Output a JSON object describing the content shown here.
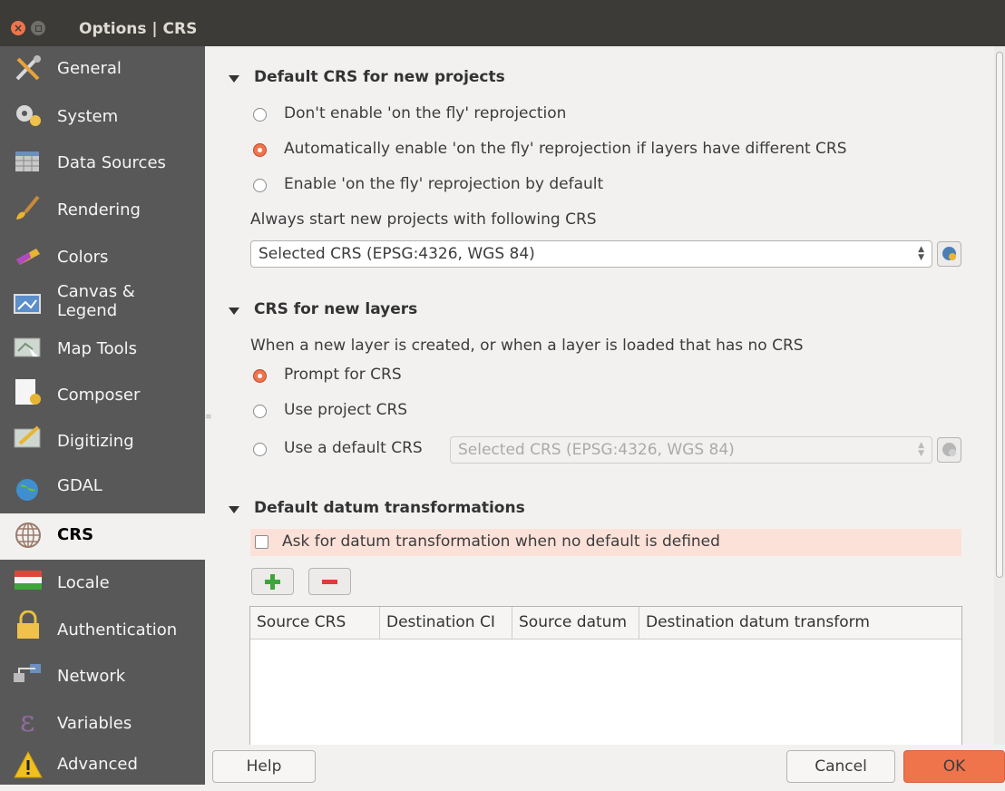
{
  "window": {
    "title": "Options | CRS"
  },
  "sidebar": {
    "items": [
      {
        "label": "General",
        "icon": "tools-icon"
      },
      {
        "label": "System",
        "icon": "gears-icon"
      },
      {
        "label": "Data Sources",
        "icon": "table-icon"
      },
      {
        "label": "Rendering",
        "icon": "brush-icon"
      },
      {
        "label": "Colors",
        "icon": "palette-icon"
      },
      {
        "label": "Canvas &",
        "label2": "Legend",
        "icon": "canvas-icon"
      },
      {
        "label": "Map Tools",
        "icon": "map-tools-icon"
      },
      {
        "label": "Composer",
        "icon": "composer-icon"
      },
      {
        "label": "Digitizing",
        "icon": "digitizing-icon"
      },
      {
        "label": "GDAL",
        "icon": "gdal-icon"
      },
      {
        "label": "CRS",
        "icon": "crs-globe-icon",
        "selected": true
      },
      {
        "label": "Locale",
        "icon": "flag-icon"
      },
      {
        "label": "Authentication",
        "icon": "lock-icon"
      },
      {
        "label": "Network",
        "icon": "network-icon"
      },
      {
        "label": "Variables",
        "icon": "epsilon-icon"
      },
      {
        "label": "Advanced",
        "icon": "warning-icon"
      }
    ]
  },
  "default_crs": {
    "title": "Default CRS for new projects",
    "options": [
      "Don't enable 'on the fly' reprojection",
      "Automatically enable 'on the fly' reprojection if layers have different CRS",
      "Enable 'on the fly' reprojection by default"
    ],
    "selected_option": 1,
    "always_start_label": "Always start new projects with following CRS",
    "crs_value": "Selected CRS (EPSG:4326, WGS 84)"
  },
  "new_layers": {
    "title": "CRS for new layers",
    "description": "When a new layer is created, or when a layer is loaded that has no CRS",
    "options": [
      "Prompt for CRS",
      "Use project CRS",
      "Use a default CRS"
    ],
    "selected_option": 0,
    "default_crs_value": "Selected CRS (EPSG:4326, WGS 84)"
  },
  "datum": {
    "title": "Default datum transformations",
    "ask_label": "Ask for datum transformation when no default is defined",
    "ask_checked": false,
    "columns": [
      "Source CRS",
      "Destination CI",
      "Source datum",
      "Destination datum transform"
    ]
  },
  "buttons": {
    "help": "Help",
    "cancel": "Cancel",
    "ok": "OK"
  },
  "colors": {
    "accent": "#f0744b",
    "sidebar": "#585858",
    "titlebar": "#3c3b37",
    "highlight": "#fce1d9"
  }
}
